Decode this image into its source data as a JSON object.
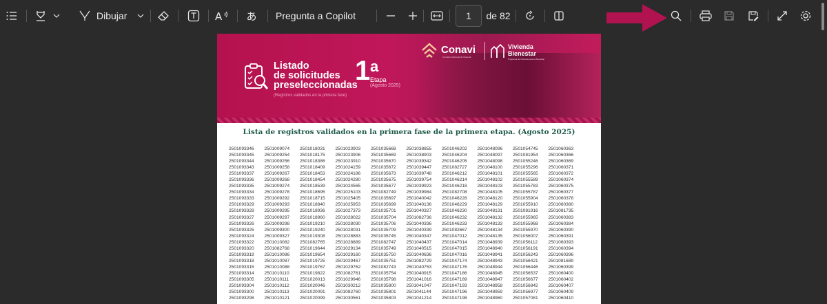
{
  "toolbar": {
    "draw_label": "Dibujar",
    "copilot_label": "Pregunta a Copilot",
    "page_current": "1",
    "page_total": "de 82",
    "icons": [
      "toc-icon",
      "highlight-icon",
      "chevron-down-icon",
      "draw-pen-icon",
      "eraser-icon",
      "text-box-icon",
      "read-aloud-icon",
      "translate-icon",
      "zoom-out-icon",
      "zoom-in-icon",
      "fit-width-icon",
      "rotate-icon",
      "page-view-icon",
      "search-icon",
      "print-icon",
      "save-icon",
      "save-as-icon",
      "fullscreen-icon",
      "settings-icon"
    ],
    "accent_arrow_color": "#b0134f"
  },
  "banner": {
    "title_line1": "Listado",
    "title_line2": "de solicitudes",
    "title_line3": "preseleccionadas",
    "subtitle": "(Registros validados en la primera fase)",
    "stage_number": "1",
    "stage_ordinal": "a",
    "stage_label": "Etapa",
    "stage_date": "(Agosto 2025)",
    "logo_conavi": "Conavi",
    "logo_conavi_sub": "Comisión Nacional de Vivienda",
    "logo_vb_line1": "Vivienda",
    "logo_vb_line2": "Bienestar",
    "logo_vb_sub": "Programa de Vivienda para el Bienestar",
    "brand_color": "#b4124e"
  },
  "document": {
    "heading": "Lista de registros validados en la primera fase de la primera etapa. (Agosto 2025)",
    "columns": [
      [
        "2501093346",
        "2501093345",
        "2501093344",
        "2501093343",
        "2501093337",
        "2501093336",
        "2501093335",
        "2501093334",
        "2501093333",
        "2501093329",
        "2501093328",
        "2501093327",
        "2501093326",
        "2501093325",
        "2501093324",
        "2501093322",
        "2501093320",
        "2501093319",
        "2501093318",
        "2501093315",
        "2501093314",
        "2501093305",
        "2501093304",
        "2501093300",
        "2501093298"
      ],
      [
        "2501009074",
        "2501009254",
        "2501009256",
        "2501009258",
        "2501009267",
        "2501009268",
        "2501009274",
        "2501009278",
        "2501009292",
        "2501009293",
        "2501009295",
        "2501009297",
        "2501009298",
        "2501009300",
        "2501009327",
        "2501010082",
        "2501082768",
        "2501010086",
        "2501010087",
        "2501010088",
        "2501010110",
        "2501010111",
        "2501010112",
        "2501010113",
        "2501010121"
      ],
      [
        "2501018031",
        "2501018175",
        "2501018386",
        "2501018409",
        "2501018453",
        "2501018454",
        "2501018539",
        "2501018695",
        "2501018715",
        "2501018840",
        "2501018936",
        "2501018960",
        "2501019210",
        "2501019240",
        "2501019308",
        "2501082765",
        "2501019644",
        "2501019654",
        "2501019725",
        "2501019767",
        "2501019822",
        "2501020013",
        "2501020046",
        "2501020091",
        "2501020099"
      ],
      [
        "2501023903",
        "2501023906",
        "2501023910",
        "2501024159",
        "2501024186",
        "2501024280",
        "2501024565",
        "2501025103",
        "2501025405",
        "2501025953",
        "2501027373",
        "2501028022",
        "2501028030",
        "2501028031",
        "2501028883",
        "2501028889",
        "2501029134",
        "2501029160",
        "2501029467",
        "2501029762",
        "2501082761",
        "2501029946",
        "2501030212",
        "2501082760",
        "2501030561"
      ],
      [
        "2501035668",
        "2501035669",
        "2501035670",
        "2501035672",
        "2501035673",
        "2501035675",
        "2501035677",
        "2501082749",
        "2501035697",
        "2501035699",
        "2501035701",
        "2501035704",
        "2501035706",
        "2501035709",
        "2501035745",
        "2501082747",
        "2501035749",
        "2501035750",
        "2501035751",
        "2501082743",
        "2501035754",
        "2501035798",
        "2501035800",
        "2501035801",
        "2501035803"
      ],
      [
        "2501038855",
        "2501038903",
        "2501039342",
        "2501039447",
        "2501039748",
        "2501039754",
        "2501039923",
        "2501039984",
        "2501040042",
        "2501040136",
        "2501040327",
        "2501082736",
        "2501040336",
        "2501040339",
        "2501040347",
        "2501040437",
        "2501040515",
        "2501040636",
        "2501082729",
        "2501040753",
        "2501040915",
        "2501041016",
        "2501041047",
        "2501041144",
        "2501041214"
      ],
      [
        "2501046202",
        "2501046204",
        "2501046205",
        "2501082727",
        "2501046212",
        "2501046214",
        "2501046218",
        "2501082708",
        "2501046228",
        "2501046229",
        "2501046230",
        "2501046232",
        "2501046233",
        "2501082667",
        "2501047012",
        "2501047014",
        "2501047015",
        "2501047016",
        "2501047174",
        "2501047176",
        "2501047186",
        "2501047189",
        "2501047193",
        "2501047196",
        "2501047198"
      ],
      [
        "2501048096",
        "2501048097",
        "2501048098",
        "2501048100",
        "2501048101",
        "2501048102",
        "2501048103",
        "2501048105",
        "2501048120",
        "2501048129",
        "2501048131",
        "2501048132",
        "2501048133",
        "2501048134",
        "2501048135",
        "2501048939",
        "2501048940",
        "2501048941",
        "2501048943",
        "2501048944",
        "2501048945",
        "2501048947",
        "2501048958",
        "2501048959",
        "2501048960"
      ],
      [
        "2501054745",
        "2501081954",
        "2501055246",
        "2501055296",
        "2501055565",
        "2501055589",
        "2501055783",
        "2501055787",
        "2501055904",
        "2501055910",
        "2501081916",
        "2501055965",
        "2501055968",
        "2501055970",
        "2501056007",
        "2501056112",
        "2501056191",
        "2501056243",
        "2501056421",
        "2501056446",
        "2501056537",
        "2501056677",
        "2501056842",
        "2501056977",
        "2501057081"
      ],
      [
        "2501060363",
        "2501060366",
        "2501060369",
        "2501060371",
        "2501060372",
        "2501060374",
        "2501060375",
        "2501060377",
        "2501060378",
        "2501060380",
        "2501081735",
        "2501060383",
        "2501060384",
        "2501060390",
        "2501060391",
        "2501060393",
        "2501060394",
        "2501060396",
        "2501081689",
        "2501060399",
        "2501060400",
        "2501060402",
        "2501060407",
        "2501060409",
        "2501060410"
      ]
    ]
  }
}
